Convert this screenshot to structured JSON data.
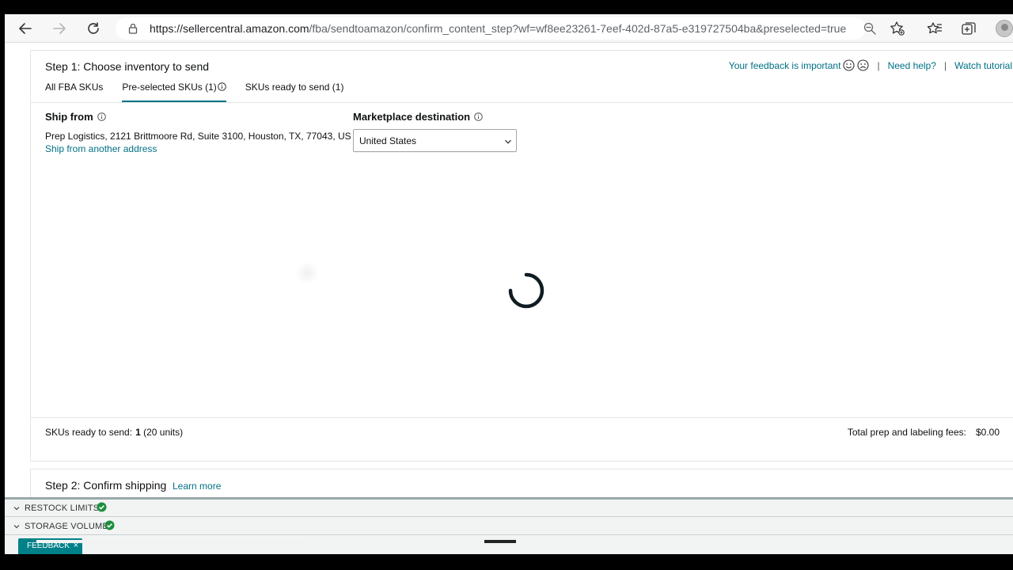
{
  "browser": {
    "url_host": "https://sellercentral.amazon.com",
    "url_path": "/fba/sendtoamazon/confirm_content_step?wf=wf8ee23261-7eef-402d-87a5-e319727504ba&preselected=true",
    "icons": [
      "back-icon",
      "forward-icon",
      "refresh-icon",
      "lock-icon",
      "zoom-icon",
      "add-favorite-icon",
      "favorites-icon",
      "collections-icon",
      "profile-avatar"
    ]
  },
  "step1": {
    "title": "Step 1: Choose inventory to send",
    "links": {
      "feedback": "Your feedback is important",
      "help": "Need help?",
      "tutorial": "Watch tutorial",
      "sep": "|"
    },
    "tabs": [
      {
        "label": "All FBA SKUs",
        "active": false
      },
      {
        "label": "Pre-selected SKUs (1)",
        "active": true
      },
      {
        "label": "SKUs ready to send (1)",
        "active": false
      }
    ],
    "ship_from": {
      "label": "Ship from",
      "address": "Prep Logistics, 2121 Brittmoore Rd, Suite 3100, Houston, TX, 77043, US",
      "change_link": "Ship from another address"
    },
    "marketplace": {
      "label": "Marketplace destination",
      "selected": "United States"
    },
    "summary": {
      "skus_label": "SKUs ready to send:",
      "skus_count": "1",
      "units": "(20 units)",
      "fees_label": "Total prep and labeling fees:",
      "fees_value": "$0.00"
    }
  },
  "step2": {
    "title": "Step 2: Confirm shipping",
    "link": "Learn more"
  },
  "bottom_panel": {
    "rows": [
      {
        "label": "RESTOCK LIMITS",
        "status": "ok"
      },
      {
        "label": "STORAGE VOLUME",
        "status": "ok"
      }
    ],
    "feedback_button": "FEEDBACK",
    "feedback_close": "×"
  },
  "colors": {
    "link": "#007185",
    "tab_underline": "#007185",
    "check_green": "#1e8e3e",
    "feedback_bg": "#00818a"
  }
}
